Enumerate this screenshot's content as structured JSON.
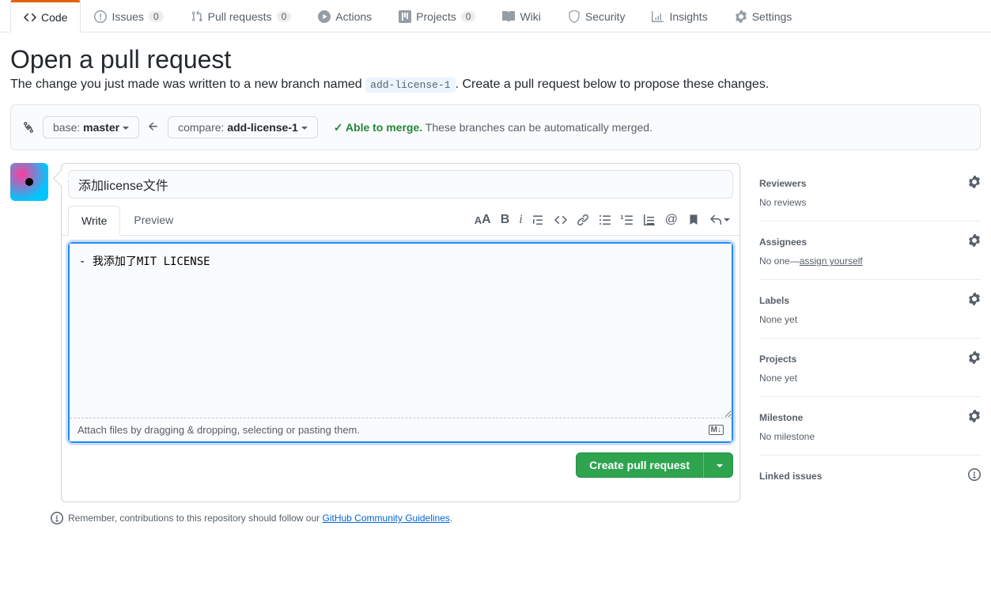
{
  "nav": {
    "code": "Code",
    "issues": "Issues",
    "issues_count": "0",
    "pulls": "Pull requests",
    "pulls_count": "0",
    "actions": "Actions",
    "projects": "Projects",
    "projects_count": "0",
    "wiki": "Wiki",
    "security": "Security",
    "insights": "Insights",
    "settings": "Settings"
  },
  "header": {
    "title": "Open a pull request",
    "desc_pre": "The change you just made was written to a new branch named ",
    "desc_branch": "add-license-1",
    "desc_post": ". Create a pull request below to propose these changes."
  },
  "compare": {
    "base_label": "base: ",
    "base_branch": "master",
    "compare_label": "compare: ",
    "compare_branch": "add-license-1",
    "check_icon": "✓",
    "merge_ok": "Able to merge.",
    "merge_txt": "These branches can be automatically merged."
  },
  "form": {
    "title_value": "添加license文件",
    "write_tab": "Write",
    "preview_tab": "Preview",
    "body_value": "- 我添加了MIT LICENSE",
    "attach_hint": "Attach files by dragging & dropping, selecting or pasting them.",
    "md_badge": "M↓",
    "submit": "Create pull request"
  },
  "hint": {
    "pre": "Remember, contributions to this repository should follow our ",
    "link": "GitHub Community Guidelines",
    "post": "."
  },
  "sidebar": {
    "reviewers": {
      "title": "Reviewers",
      "value": "No reviews"
    },
    "assignees": {
      "title": "Assignees",
      "value_pre": "No one—",
      "value_link": "assign yourself"
    },
    "labels": {
      "title": "Labels",
      "value": "None yet"
    },
    "projects": {
      "title": "Projects",
      "value": "None yet"
    },
    "milestone": {
      "title": "Milestone",
      "value": "No milestone"
    },
    "linked": {
      "title": "Linked issues"
    }
  }
}
